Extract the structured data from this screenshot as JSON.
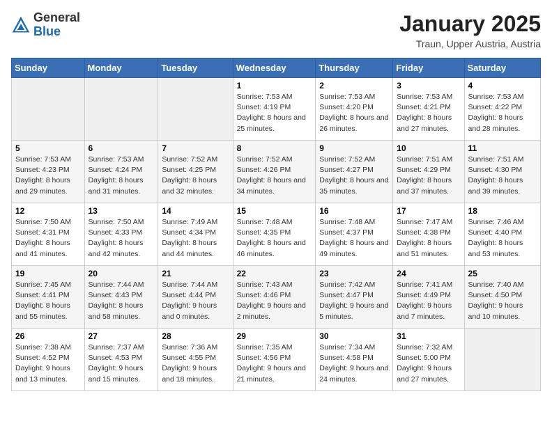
{
  "header": {
    "logo": {
      "line1": "General",
      "line2": "Blue"
    },
    "title": "January 2025",
    "subtitle": "Traun, Upper Austria, Austria"
  },
  "weekdays": [
    "Sunday",
    "Monday",
    "Tuesday",
    "Wednesday",
    "Thursday",
    "Friday",
    "Saturday"
  ],
  "weeks": [
    [
      {
        "day": "",
        "sunrise": "",
        "sunset": "",
        "daylight": ""
      },
      {
        "day": "",
        "sunrise": "",
        "sunset": "",
        "daylight": ""
      },
      {
        "day": "",
        "sunrise": "",
        "sunset": "",
        "daylight": ""
      },
      {
        "day": "1",
        "sunrise": "Sunrise: 7:53 AM",
        "sunset": "Sunset: 4:19 PM",
        "daylight": "Daylight: 8 hours and 25 minutes."
      },
      {
        "day": "2",
        "sunrise": "Sunrise: 7:53 AM",
        "sunset": "Sunset: 4:20 PM",
        "daylight": "Daylight: 8 hours and 26 minutes."
      },
      {
        "day": "3",
        "sunrise": "Sunrise: 7:53 AM",
        "sunset": "Sunset: 4:21 PM",
        "daylight": "Daylight: 8 hours and 27 minutes."
      },
      {
        "day": "4",
        "sunrise": "Sunrise: 7:53 AM",
        "sunset": "Sunset: 4:22 PM",
        "daylight": "Daylight: 8 hours and 28 minutes."
      }
    ],
    [
      {
        "day": "5",
        "sunrise": "Sunrise: 7:53 AM",
        "sunset": "Sunset: 4:23 PM",
        "daylight": "Daylight: 8 hours and 29 minutes."
      },
      {
        "day": "6",
        "sunrise": "Sunrise: 7:53 AM",
        "sunset": "Sunset: 4:24 PM",
        "daylight": "Daylight: 8 hours and 31 minutes."
      },
      {
        "day": "7",
        "sunrise": "Sunrise: 7:52 AM",
        "sunset": "Sunset: 4:25 PM",
        "daylight": "Daylight: 8 hours and 32 minutes."
      },
      {
        "day": "8",
        "sunrise": "Sunrise: 7:52 AM",
        "sunset": "Sunset: 4:26 PM",
        "daylight": "Daylight: 8 hours and 34 minutes."
      },
      {
        "day": "9",
        "sunrise": "Sunrise: 7:52 AM",
        "sunset": "Sunset: 4:27 PM",
        "daylight": "Daylight: 8 hours and 35 minutes."
      },
      {
        "day": "10",
        "sunrise": "Sunrise: 7:51 AM",
        "sunset": "Sunset: 4:29 PM",
        "daylight": "Daylight: 8 hours and 37 minutes."
      },
      {
        "day": "11",
        "sunrise": "Sunrise: 7:51 AM",
        "sunset": "Sunset: 4:30 PM",
        "daylight": "Daylight: 8 hours and 39 minutes."
      }
    ],
    [
      {
        "day": "12",
        "sunrise": "Sunrise: 7:50 AM",
        "sunset": "Sunset: 4:31 PM",
        "daylight": "Daylight: 8 hours and 41 minutes."
      },
      {
        "day": "13",
        "sunrise": "Sunrise: 7:50 AM",
        "sunset": "Sunset: 4:33 PM",
        "daylight": "Daylight: 8 hours and 42 minutes."
      },
      {
        "day": "14",
        "sunrise": "Sunrise: 7:49 AM",
        "sunset": "Sunset: 4:34 PM",
        "daylight": "Daylight: 8 hours and 44 minutes."
      },
      {
        "day": "15",
        "sunrise": "Sunrise: 7:48 AM",
        "sunset": "Sunset: 4:35 PM",
        "daylight": "Daylight: 8 hours and 46 minutes."
      },
      {
        "day": "16",
        "sunrise": "Sunrise: 7:48 AM",
        "sunset": "Sunset: 4:37 PM",
        "daylight": "Daylight: 8 hours and 49 minutes."
      },
      {
        "day": "17",
        "sunrise": "Sunrise: 7:47 AM",
        "sunset": "Sunset: 4:38 PM",
        "daylight": "Daylight: 8 hours and 51 minutes."
      },
      {
        "day": "18",
        "sunrise": "Sunrise: 7:46 AM",
        "sunset": "Sunset: 4:40 PM",
        "daylight": "Daylight: 8 hours and 53 minutes."
      }
    ],
    [
      {
        "day": "19",
        "sunrise": "Sunrise: 7:45 AM",
        "sunset": "Sunset: 4:41 PM",
        "daylight": "Daylight: 8 hours and 55 minutes."
      },
      {
        "day": "20",
        "sunrise": "Sunrise: 7:44 AM",
        "sunset": "Sunset: 4:43 PM",
        "daylight": "Daylight: 8 hours and 58 minutes."
      },
      {
        "day": "21",
        "sunrise": "Sunrise: 7:44 AM",
        "sunset": "Sunset: 4:44 PM",
        "daylight": "Daylight: 9 hours and 0 minutes."
      },
      {
        "day": "22",
        "sunrise": "Sunrise: 7:43 AM",
        "sunset": "Sunset: 4:46 PM",
        "daylight": "Daylight: 9 hours and 2 minutes."
      },
      {
        "day": "23",
        "sunrise": "Sunrise: 7:42 AM",
        "sunset": "Sunset: 4:47 PM",
        "daylight": "Daylight: 9 hours and 5 minutes."
      },
      {
        "day": "24",
        "sunrise": "Sunrise: 7:41 AM",
        "sunset": "Sunset: 4:49 PM",
        "daylight": "Daylight: 9 hours and 7 minutes."
      },
      {
        "day": "25",
        "sunrise": "Sunrise: 7:40 AM",
        "sunset": "Sunset: 4:50 PM",
        "daylight": "Daylight: 9 hours and 10 minutes."
      }
    ],
    [
      {
        "day": "26",
        "sunrise": "Sunrise: 7:38 AM",
        "sunset": "Sunset: 4:52 PM",
        "daylight": "Daylight: 9 hours and 13 minutes."
      },
      {
        "day": "27",
        "sunrise": "Sunrise: 7:37 AM",
        "sunset": "Sunset: 4:53 PM",
        "daylight": "Daylight: 9 hours and 15 minutes."
      },
      {
        "day": "28",
        "sunrise": "Sunrise: 7:36 AM",
        "sunset": "Sunset: 4:55 PM",
        "daylight": "Daylight: 9 hours and 18 minutes."
      },
      {
        "day": "29",
        "sunrise": "Sunrise: 7:35 AM",
        "sunset": "Sunset: 4:56 PM",
        "daylight": "Daylight: 9 hours and 21 minutes."
      },
      {
        "day": "30",
        "sunrise": "Sunrise: 7:34 AM",
        "sunset": "Sunset: 4:58 PM",
        "daylight": "Daylight: 9 hours and 24 minutes."
      },
      {
        "day": "31",
        "sunrise": "Sunrise: 7:32 AM",
        "sunset": "Sunset: 5:00 PM",
        "daylight": "Daylight: 9 hours and 27 minutes."
      },
      {
        "day": "",
        "sunrise": "",
        "sunset": "",
        "daylight": ""
      }
    ]
  ]
}
